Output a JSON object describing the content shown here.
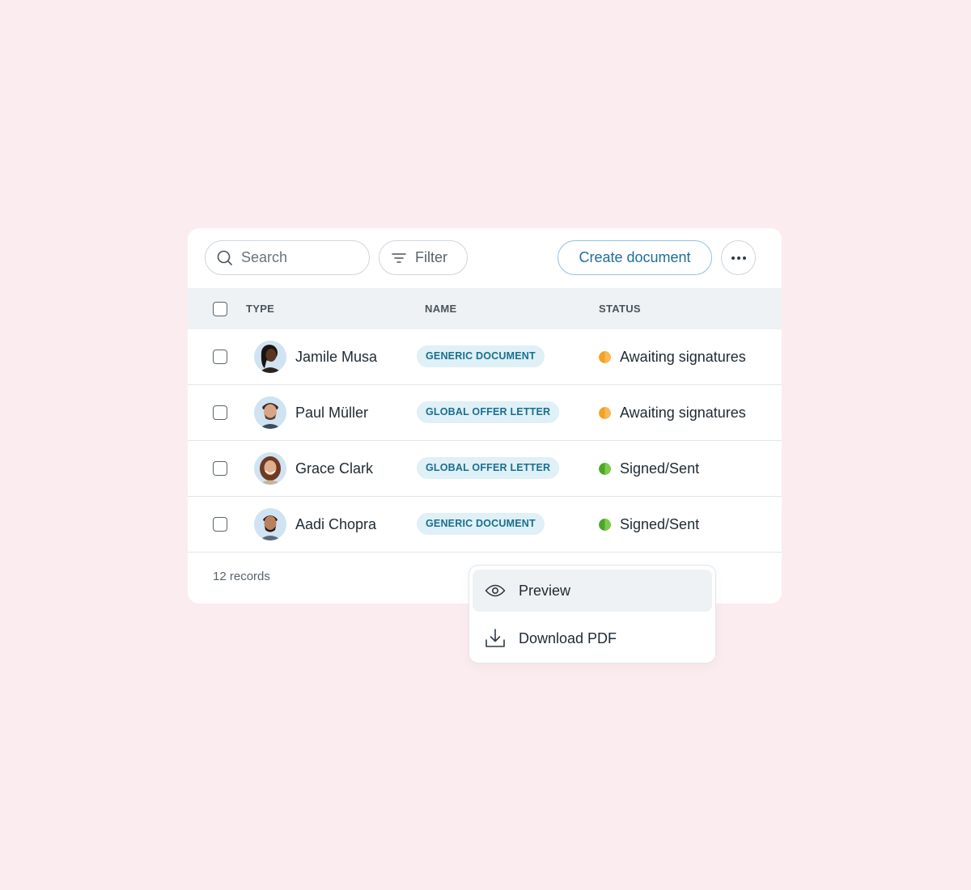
{
  "toolbar": {
    "search_placeholder": "Search",
    "filter_label": "Filter",
    "create_label": "Create document",
    "more_icon": "more-horizontal-icon"
  },
  "table": {
    "columns": [
      "TYPE",
      "NAME",
      "STATUS"
    ],
    "rows": [
      {
        "name": "Jamile Musa",
        "type_tag": "GENERIC DOCUMENT",
        "status": "Awaiting signatures",
        "status_kind": "pending"
      },
      {
        "name": "Paul Müller",
        "type_tag": "GLOBAL OFFER LETTER",
        "status": "Awaiting signatures",
        "status_kind": "pending"
      },
      {
        "name": "Grace Clark",
        "type_tag": "GLOBAL OFFER LETTER",
        "status": "Signed/Sent",
        "status_kind": "done"
      },
      {
        "name": "Aadi Chopra",
        "type_tag": "GENERIC DOCUMENT",
        "status": "Signed/Sent",
        "status_kind": "done"
      }
    ],
    "footer": "12 records"
  },
  "context_menu": {
    "items": [
      {
        "label": "Preview",
        "icon": "eye-icon",
        "active": true
      },
      {
        "label": "Download PDF",
        "icon": "download-icon",
        "active": false
      }
    ]
  },
  "colors": {
    "background": "#fbecef",
    "accent": "#1e6e9a",
    "status_pending": "#f4a223",
    "status_done": "#5cb82e"
  }
}
